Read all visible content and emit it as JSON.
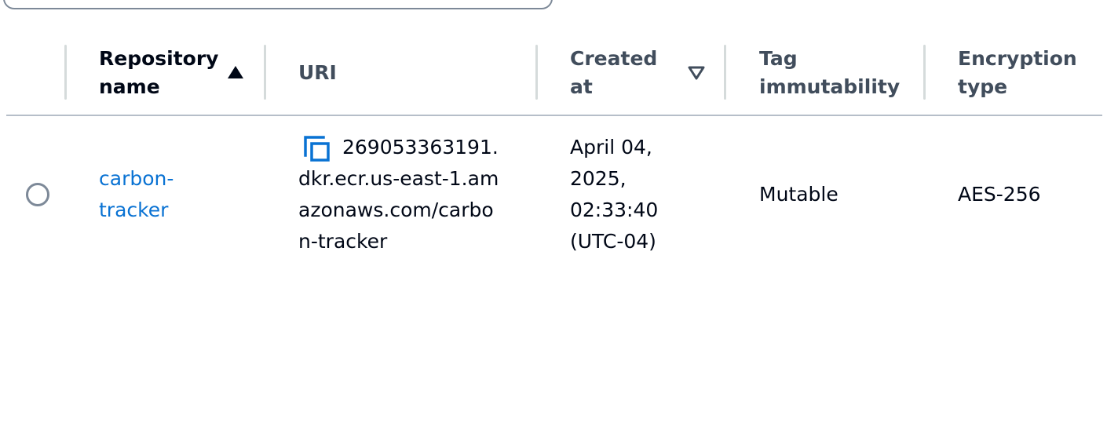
{
  "table": {
    "columns": {
      "repository_name": "Repository name",
      "repository_name_line1": "Repository",
      "repository_name_line2": "name",
      "uri": "URI",
      "created_at_line1": "Created",
      "created_at_line2": "at",
      "tag_immutability_line1": "Tag",
      "tag_immutability_line2": "immutability",
      "encryption_type_line1": "Encryption",
      "encryption_type_line2": "type"
    },
    "sort": {
      "repository_name": "ascending",
      "created_at": "none"
    },
    "rows": [
      {
        "selected": false,
        "repository_name_line1": "carbon-",
        "repository_name_line2": "tracker",
        "uri_line1": "269053363191.",
        "uri_line2": "dkr.ecr.us-east-1.am",
        "uri_line3": "azonaws.com/carbo",
        "uri_line4": "n-tracker",
        "created_line1": "April 04,",
        "created_line2": "2025,",
        "created_line3": "02:33:40",
        "created_line4": "(UTC-04)",
        "tag_immutability": "Mutable",
        "encryption_type": "AES-256"
      }
    ]
  },
  "icons": {
    "copy": "copy-icon",
    "sort_ascending": "caret-up-filled-icon",
    "sort_none": "caret-down-outline-icon",
    "radio": "radio-unselected-icon"
  },
  "colors": {
    "link": "#0972d3",
    "text": "#000716",
    "header_muted": "#414d5c",
    "separator": "#d5dbdb",
    "rule": "#b6bec9"
  }
}
